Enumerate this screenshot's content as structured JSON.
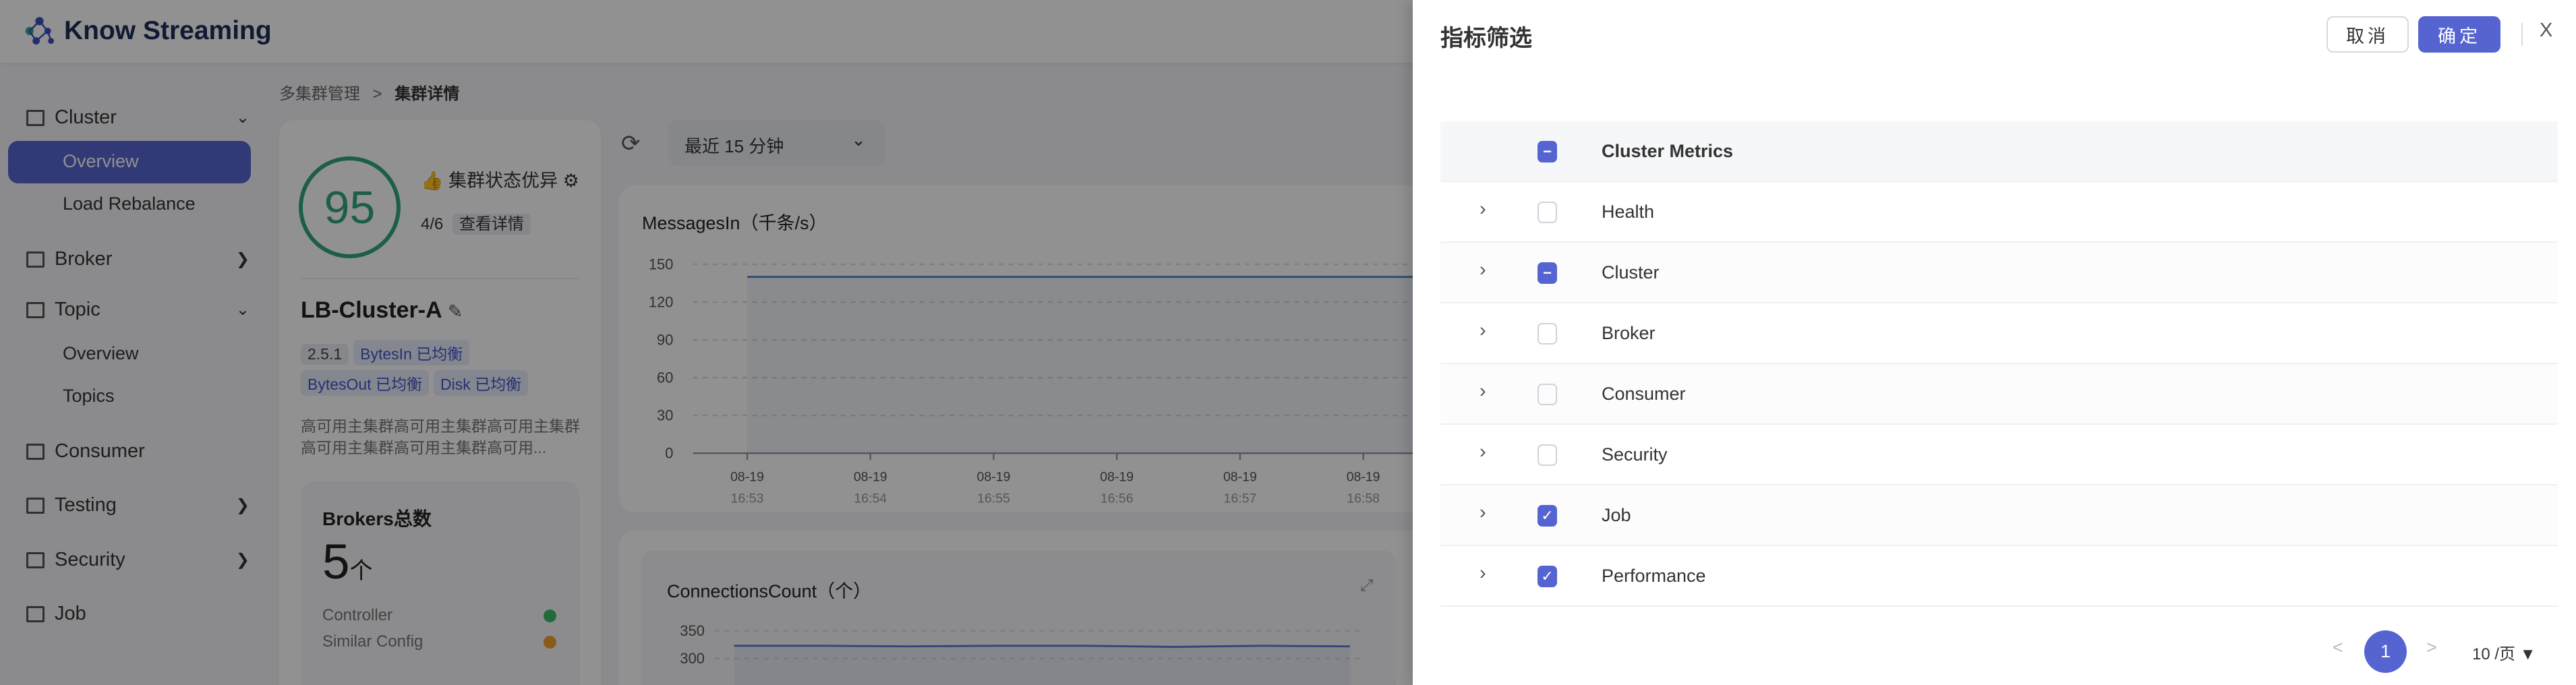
{
  "app": {
    "name": "Know Streaming"
  },
  "breadcrumb": {
    "parent": "多集群管理",
    "sep": ">",
    "current": "集群详情"
  },
  "sidebar": {
    "items": [
      {
        "label": "Cluster",
        "chevron": "v"
      },
      {
        "label": "Overview",
        "sub": true,
        "active": true
      },
      {
        "label": "Load Rebalance",
        "sub": true
      },
      {
        "label": "Broker",
        "chevron": ">"
      },
      {
        "label": "Topic",
        "chevron": "v"
      },
      {
        "label": "Overview",
        "sub": true
      },
      {
        "label": "Topics",
        "sub": true
      },
      {
        "label": "Consumer"
      },
      {
        "label": "Testing",
        "chevron": ">"
      },
      {
        "label": "Security",
        "chevron": ">"
      },
      {
        "label": "Job"
      }
    ]
  },
  "cluster": {
    "score": "95",
    "status": "集群状态优异",
    "checks": "4/6",
    "details_link": "查看详情",
    "name": "LB-Cluster-A",
    "tags": [
      "2.5.1",
      "BytesIn 已均衡",
      "BytesOut 已均衡",
      "Disk 已均衡"
    ],
    "description": "高可用主集群高可用主集群高可用主集群高可用主集群高可用主集群高可用...",
    "brokers_title": "Brokers总数",
    "brokers_count": "5",
    "brokers_unit": "个",
    "controller": "Controller",
    "similar_config": "Similar Config"
  },
  "toolbar": {
    "time_range": "最近 15 分钟"
  },
  "chart_data": [
    {
      "type": "line",
      "title": "MessagesIn（千条/s）",
      "ylim": [
        0,
        150
      ],
      "yticks": [
        "150",
        "120",
        "90",
        "60",
        "30",
        "0"
      ],
      "x": [
        "08-19|16:53",
        "08-19|16:54",
        "08-19|16:55",
        "08-19|16:56",
        "08-19|16:57",
        "08-19|16:58"
      ],
      "xdates": [
        "08-19",
        "08-19",
        "08-19",
        "08-19",
        "08-19",
        "08-19"
      ],
      "xtimes": [
        "16:53",
        "16:54",
        "16:55",
        "16:56",
        "16:57",
        "16:58"
      ],
      "values": [
        140,
        140,
        140,
        140,
        140,
        140
      ]
    },
    {
      "type": "line",
      "title": "ConnectionsCount（个）",
      "ylim": [
        250,
        350
      ],
      "yticks": [
        "350",
        "300"
      ],
      "values": [
        323,
        323,
        322,
        323,
        323,
        321,
        323,
        322
      ]
    }
  ],
  "drawer": {
    "title": "指标筛选",
    "cancel": "取消",
    "confirm": "确定",
    "close": "X",
    "header": {
      "label": "Cluster Metrics",
      "state": "partial"
    },
    "rows": [
      {
        "label": "Health",
        "state": "unchecked"
      },
      {
        "label": "Cluster",
        "state": "partial"
      },
      {
        "label": "Broker",
        "state": "unchecked"
      },
      {
        "label": "Consumer",
        "state": "unchecked"
      },
      {
        "label": "Security",
        "state": "unchecked"
      },
      {
        "label": "Job",
        "state": "checked"
      },
      {
        "label": "Performance",
        "state": "checked"
      }
    ],
    "pagination": {
      "prev": "<",
      "page": "1",
      "next": ">",
      "page_size": "10 /页"
    }
  },
  "colors": {
    "primary": "#5664d2",
    "score": "#34a77c"
  }
}
